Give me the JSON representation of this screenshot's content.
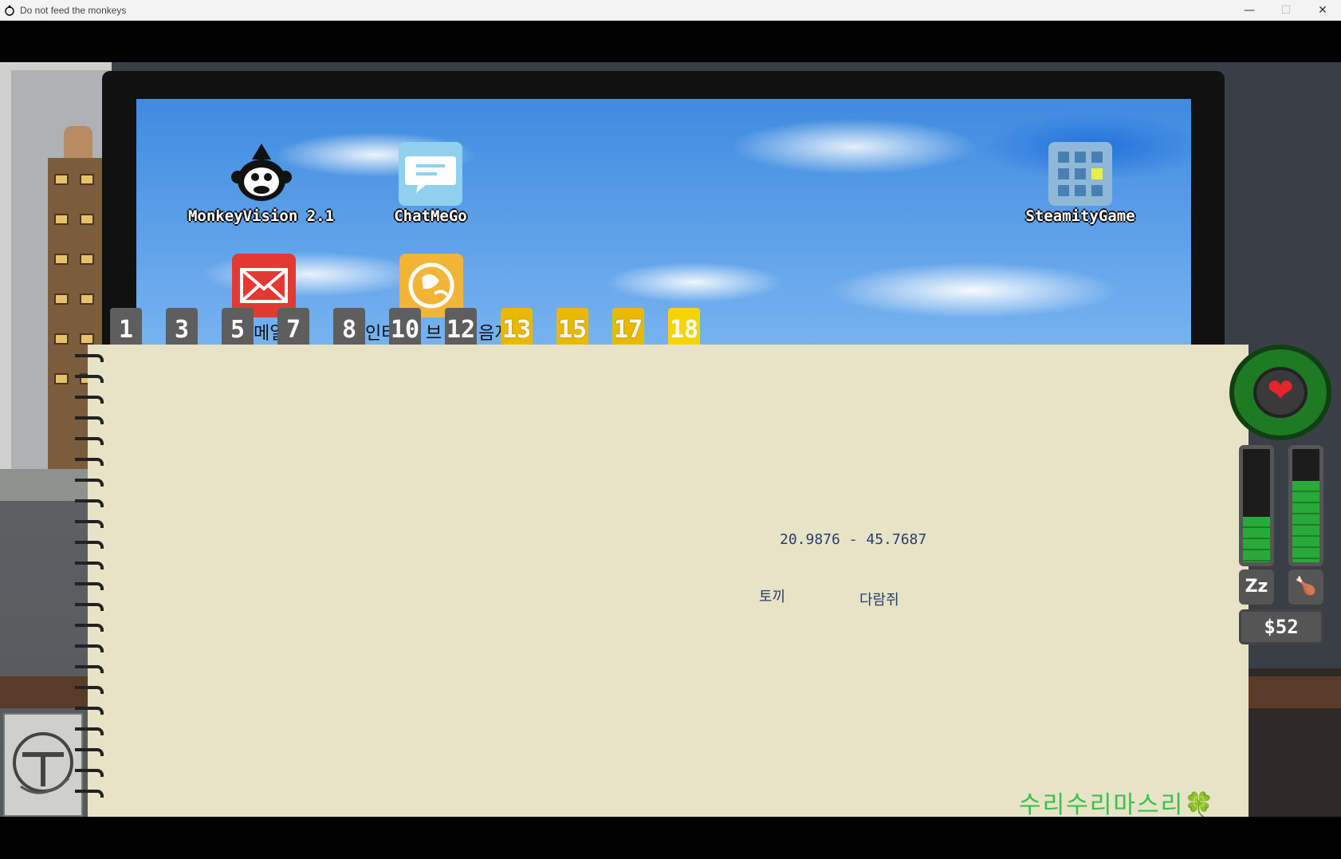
{
  "window": {
    "title": "Do not feed the monkeys",
    "minimize_label": "—",
    "maximize_label": "☐",
    "close_label": "✕"
  },
  "desktop": {
    "icons": [
      {
        "id": "monkeyvision",
        "label": "MonkeyVision 2.1",
        "icon": "monkey-face-icon"
      },
      {
        "id": "chatmego",
        "label": "ChatMeGo",
        "icon": "chat-bubble-icon"
      },
      {
        "id": "steamitygame",
        "label": "SteamityGame",
        "icon": "grid-app-icon"
      },
      {
        "id": "mail",
        "label": "",
        "icon": "envelope-icon"
      },
      {
        "id": "browser",
        "label": "",
        "icon": "globe-icon"
      }
    ]
  },
  "notebook": {
    "tabs": [
      {
        "num": "1",
        "style": "gray"
      },
      {
        "num": "3",
        "style": "gray"
      },
      {
        "num": "5",
        "style": "gray"
      },
      {
        "num": "7",
        "style": "gray"
      },
      {
        "num": "8",
        "style": "gray"
      },
      {
        "num": "10",
        "style": "gray"
      },
      {
        "num": "12",
        "style": "gray"
      },
      {
        "num": "13",
        "style": "yellow"
      },
      {
        "num": "15",
        "style": "yellow"
      },
      {
        "num": "17",
        "style": "yellow"
      },
      {
        "num": "18",
        "style": "active"
      }
    ],
    "tab_fragments": [
      "메일",
      "인터",
      "브",
      "음지"
    ],
    "coords": "20.9876 - 45.7687",
    "words": [
      "토끼",
      "다람쥐"
    ],
    "signature": "수리수리마스리🍀"
  },
  "hud": {
    "sleep_level": 0.4,
    "food_level": 0.72,
    "sleep_icon_text": "Zz",
    "food_icon_text": "🍗",
    "money": "$52",
    "health_icon": "heart-icon",
    "colors": {
      "bar": "#29a93a",
      "heart": "#e3262b",
      "signature": "#3bbf4b"
    }
  }
}
